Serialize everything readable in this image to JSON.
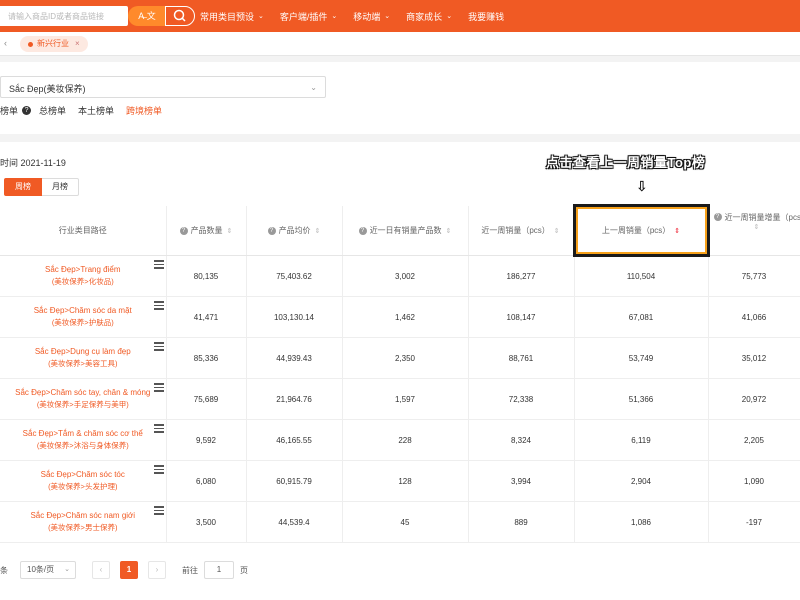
{
  "colors": {
    "accent": "#f05a24",
    "highlight_border": "#f7a11a"
  },
  "topbar": {
    "search_placeholder": "请输入商品ID或者商品链接",
    "translate_label": "A̶ 文",
    "nav": [
      {
        "label": "常用类目预设"
      },
      {
        "label": "客户端/插件"
      },
      {
        "label": "移动端"
      },
      {
        "label": "商家成长"
      },
      {
        "label": "我要赚钱"
      }
    ]
  },
  "tabstrip": {
    "active_tab": "新兴行业"
  },
  "filters": {
    "category_value": "Sắc Đẹp(美妆保养)",
    "rank_label": "榜单",
    "rank_options": [
      "总榜单",
      "本土榜单",
      "跨境榜单"
    ],
    "active_rank": "跨境榜单"
  },
  "main": {
    "update_time": "时间 2021-11-19",
    "period_tabs": [
      "周榜",
      "月榜"
    ],
    "active_period": "周榜",
    "annotation": "点击查看上一周销量Top榜",
    "annotation_arrow": "⇩"
  },
  "table": {
    "headers": [
      "行业类目路径",
      "产品数量",
      "产品均价",
      "近一日有销量产品数",
      "近一周销量（pcs）",
      "上一周销量（pcs）",
      "近一周销量增量（pcs）"
    ],
    "rows": [
      {
        "cat_vi": "Sắc Đẹp>Trang điểm",
        "cat_zh": "(美妆保养>化妆品)",
        "cells": [
          "80,135",
          "75,403.62",
          "3,002",
          "186,277",
          "110,504",
          "75,773"
        ]
      },
      {
        "cat_vi": "Sắc Đẹp>Chăm sóc da mặt",
        "cat_zh": "(美妆保养>护肤品)",
        "cells": [
          "41,471",
          "103,130.14",
          "1,462",
          "108,147",
          "67,081",
          "41,066"
        ]
      },
      {
        "cat_vi": "Sắc Đẹp>Dụng cụ làm đẹp",
        "cat_zh": "(美妆保养>美容工具)",
        "cells": [
          "85,336",
          "44,939.43",
          "2,350",
          "88,761",
          "53,749",
          "35,012"
        ]
      },
      {
        "cat_vi": "Sắc Đẹp>Chăm sóc tay, chân & móng",
        "cat_zh": "(美妆保养>手足保养与美甲)",
        "cells": [
          "75,689",
          "21,964.76",
          "1,597",
          "72,338",
          "51,366",
          "20,972"
        ]
      },
      {
        "cat_vi": "Sắc Đẹp>Tắm & chăm sóc cơ thể",
        "cat_zh": "(美妆保养>沐浴与身体保养)",
        "cells": [
          "9,592",
          "46,165.55",
          "228",
          "8,324",
          "6,119",
          "2,205"
        ]
      },
      {
        "cat_vi": "Sắc Đẹp>Chăm sóc tóc",
        "cat_zh": "(美妆保养>头发护理)",
        "cells": [
          "6,080",
          "60,915.79",
          "128",
          "3,994",
          "2,904",
          "1,090"
        ]
      },
      {
        "cat_vi": "Sắc Đẹp>Chăm sóc nam giới",
        "cat_zh": "(美妆保养>男士保养)",
        "cells": [
          "3,500",
          "44,539.4",
          "45",
          "889",
          "1,086",
          "-197"
        ]
      }
    ]
  },
  "pager": {
    "total_suffix": "条",
    "page_size": "10条/页",
    "prev": "‹",
    "next": "›",
    "current_page": "1",
    "goto_label": "前往",
    "goto_value": "1",
    "page_suffix": "页"
  }
}
